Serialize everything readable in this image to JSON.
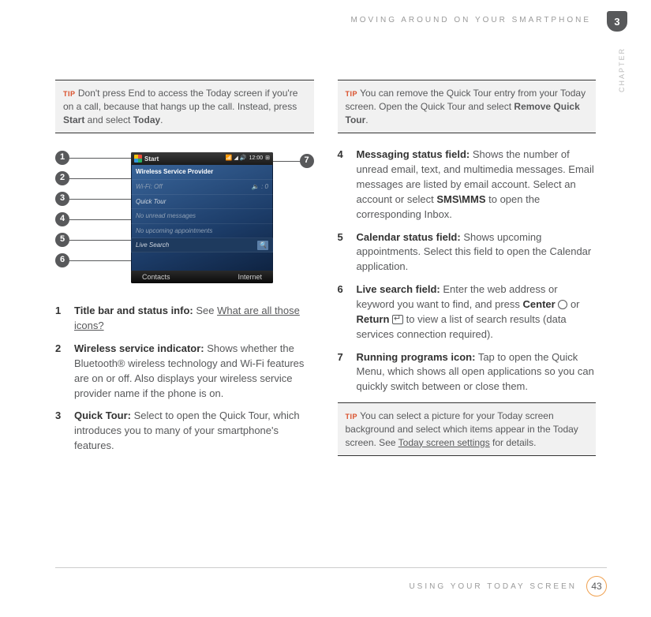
{
  "header": {
    "running_title": "MOVING AROUND ON YOUR SMARTPHONE",
    "chapter_number": "3",
    "chapter_side": "CHAPTER"
  },
  "left": {
    "tip1": {
      "label": "TIP",
      "text_parts": [
        "Don't press End to access the Today screen if you're on a call, because that hangs up the call. Instead, press ",
        "Start",
        " and select ",
        "Today",
        "."
      ]
    },
    "screenshot": {
      "start": "Start",
      "clock": "12:00",
      "provider": "Wireless Service Provider",
      "wifi": "Wi-Fi: Off",
      "quick_tour": "Quick Tour",
      "msgs": "No unread messages",
      "appts": "No upcoming appointments",
      "search": "Live Search",
      "soft_left": "Contacts",
      "soft_right": "Internet"
    },
    "callouts_left": [
      "1",
      "2",
      "3",
      "4",
      "5",
      "6"
    ],
    "callouts_right": [
      "7"
    ],
    "items": [
      {
        "n": "1",
        "title": "Title bar and status info:",
        "body_prefix": " See ",
        "link": "What are all those icons?",
        "body_suffix": ""
      },
      {
        "n": "2",
        "title": "Wireless service indicator:",
        "body": " Shows whether the Bluetooth® wireless technology and Wi-Fi features are on or off. Also displays your wireless service provider name if the phone is on."
      },
      {
        "n": "3",
        "title": "Quick Tour:",
        "body": " Select to open the Quick Tour, which introduces you to many of your smartphone's features."
      }
    ]
  },
  "right": {
    "tip1": {
      "label": "TIP",
      "text_parts": [
        "You can remove the Quick Tour entry from your Today screen. Open the Quick Tour and select ",
        "Remove Quick Tour",
        "."
      ]
    },
    "items": [
      {
        "n": "4",
        "title": "Messaging status field:",
        "body_a": " Shows the number of unread email, text, and multimedia messages. Email messages are listed by email account. Select an account or select ",
        "bold": "SMS\\MMS",
        "body_b": " to open the corresponding Inbox."
      },
      {
        "n": "5",
        "title": "Calendar status field:",
        "body": " Shows upcoming appointments. Select this field to open the Calendar application."
      },
      {
        "n": "6",
        "title": "Live search field:",
        "body_a": " Enter the web address or keyword you want to find, and press ",
        "bold1": "Center",
        "mid": " or ",
        "bold2": "Return",
        "body_b": " to view a list of search results (data services connection required)."
      },
      {
        "n": "7",
        "title": "Running programs icon:",
        "body": " Tap to open the Quick Menu, which shows all open applications so you can quickly switch between or close them."
      }
    ],
    "tip2": {
      "label": "TIP",
      "text_a": "You can select a picture for your Today screen background and select which items appear in the Today screen. See ",
      "link": "Today screen settings",
      "text_b": " for details."
    }
  },
  "footer": {
    "section": "USING YOUR TODAY SCREEN",
    "page": "43"
  }
}
